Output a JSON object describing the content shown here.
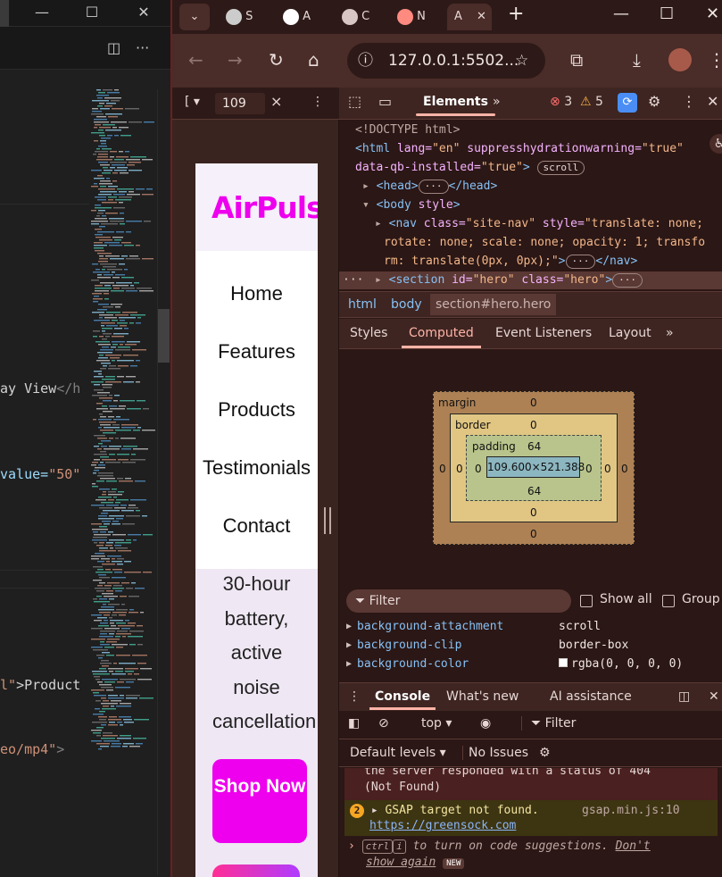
{
  "vscode": {
    "titlebar": {
      "minimize": "—",
      "maximize": "☐",
      "close": "✕"
    },
    "tabbar": {
      "split": "◫",
      "more": "···"
    },
    "code_lines": [
      {
        "pre": "ay View",
        "tag": "</h"
      },
      {
        "att": "value=",
        "str": "\"50\""
      },
      {
        "str": "l\"",
        "txt": ">Product"
      },
      {
        "str": "eo/mp4\"",
        "tag": ">"
      }
    ]
  },
  "chrome": {
    "tabs": [
      {
        "label": "S",
        "fav_color": "#cccccc"
      },
      {
        "label": "A",
        "fav_color": "#ffffff"
      },
      {
        "label": "C",
        "fav_color": "#d7c6c3"
      },
      {
        "label": "N",
        "fav_color": "#ff8a80"
      },
      {
        "label": "A",
        "active": true
      }
    ],
    "tab_close": "✕",
    "new_tab": "+",
    "window": {
      "minimize": "—",
      "maximize": "☐",
      "close": "✕"
    },
    "url": "127.0.0.1:5502...",
    "toolbar_icons": {
      "back": "←",
      "forward": "→",
      "reload": "↻",
      "home": "⌂",
      "site_info": "ⓘ",
      "star": "☆",
      "extensions": "⧉",
      "download": "⤓",
      "menu": "⋮"
    }
  },
  "device_toolbar": {
    "device": "[ ▾",
    "zoom": "109",
    "clear": "×",
    "more": "⋮"
  },
  "page": {
    "logo": "AirPuls",
    "nav": [
      "Home",
      "Features",
      "Products",
      "Testimonials",
      "Contact"
    ],
    "hero_lines": [
      "30-hour",
      "battery,",
      "active",
      "noise",
      "cancellation"
    ],
    "cta": "Shop Now"
  },
  "devtools": {
    "tabs": {
      "elements": "Elements",
      "more": "»"
    },
    "errors": "3",
    "warnings": "5",
    "dom": {
      "doctype": "<!DOCTYPE html>",
      "html_open": "<html",
      "lang_attr": "lang=",
      "lang_val": "\"en\"",
      "hydration_attr": "suppresshydrationwarning=",
      "hydration_val": "\"true\"",
      "qb_attr": "data-qb-installed=",
      "qb_val": "\"true\"",
      "scroll_pill": "scroll",
      "head": "<head>",
      "head_close": "</head>",
      "body_open": "<body",
      "body_style": "style",
      "nav_open": "<nav",
      "class_attr": "class=",
      "nav_class": "\"site-nav\"",
      "style_attr": "style=",
      "nav_style_1": "\"translate: none;",
      "nav_style_2": "rotate: none; scale: none; opacity: 1; transfo",
      "nav_style_3": "rm: translate(0px, 0px);\"",
      "nav_close": "</nav>",
      "section_open": "<section",
      "id_attr": "id=",
      "section_id": "\"hero\"",
      "section_class": "\"hero\"",
      "ellipsis": "···",
      "dots_left": "···"
    },
    "breadcrumb": [
      "html",
      "body",
      "section#hero.hero"
    ],
    "subtabs": [
      "Styles",
      "Computed",
      "Event Listeners",
      "Layout",
      "»"
    ],
    "box_model": {
      "margin_label": "margin",
      "border_label": "border",
      "padding_label": "padding",
      "margin": {
        "top": "0",
        "right": "0",
        "bottom": "0",
        "left": "0"
      },
      "border": {
        "top": "0",
        "right": "0",
        "bottom": "0",
        "left": "0"
      },
      "padding": {
        "top": "64",
        "right": "0",
        "bottom": "64",
        "left": "0"
      },
      "content": "109.600×521.388"
    },
    "filter": {
      "placeholder": "Filter",
      "show_all": "Show all",
      "group": "Group"
    },
    "properties": [
      {
        "name": "background-attachment",
        "value": "scroll"
      },
      {
        "name": "background-clip",
        "value": "border-box"
      },
      {
        "name": "background-color",
        "value": "rgba(0, 0, 0, 0)"
      }
    ],
    "drawer_tabs": [
      "Console",
      "What's new",
      "AI assistance"
    ],
    "console_toolbar": {
      "context": "top ▾",
      "filter": "Filter"
    },
    "levels": {
      "default": "Default levels ▾",
      "issues": "No Issues"
    },
    "messages": {
      "error_1": "the server responded with a status of 404",
      "error_2": "(Not Found)",
      "warn_count": "2",
      "warn_text": "GSAP target  not found.",
      "warn_src": "gsap.min.js:10",
      "warn_link": "https://greensock.com",
      "hint_ctrl": "ctrl",
      "hint_i": "i",
      "hint_text": "to turn on code suggestions.",
      "hint_dont": "Don't",
      "hint_show": "show again",
      "hint_new": "NEW"
    }
  }
}
